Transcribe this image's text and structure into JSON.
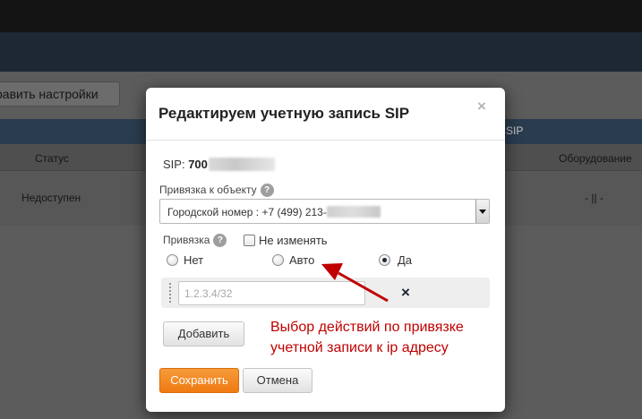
{
  "background": {
    "settings_button": "равить настройки",
    "sip_column": "SIP",
    "columns": {
      "status": "Статус",
      "equipment": "Оборудование"
    },
    "row": {
      "status": "Недоступен",
      "equipment": "- || -"
    }
  },
  "modal": {
    "title": "Редактируем учетную запись SIP",
    "close_symbol": "×",
    "sip_label": "SIP:",
    "sip_value_visible": "700",
    "object_binding_label": "Привязка к объекту",
    "object_select_value": "Городской номер : +7 (499) 213-",
    "binding_label": "Привязка",
    "no_change_label": "Не изменять",
    "no_change_checked": false,
    "radio_options": [
      {
        "label": "Нет",
        "checked": false
      },
      {
        "label": "Авто",
        "checked": false
      },
      {
        "label": "Да",
        "checked": true
      }
    ],
    "ip_placeholder": "1.2.3.4/32",
    "remove_symbol": "×",
    "add_button": "Добавить",
    "save_button": "Сохранить",
    "cancel_button": "Отмена",
    "help_symbol": "?"
  },
  "annotation": {
    "line1": "Выбор действий по привязке",
    "line2": "учетной записи к ip адресу",
    "color": "#c00000"
  },
  "colors": {
    "accent_orange": "#f08a24",
    "annotation_red": "#c00000"
  }
}
